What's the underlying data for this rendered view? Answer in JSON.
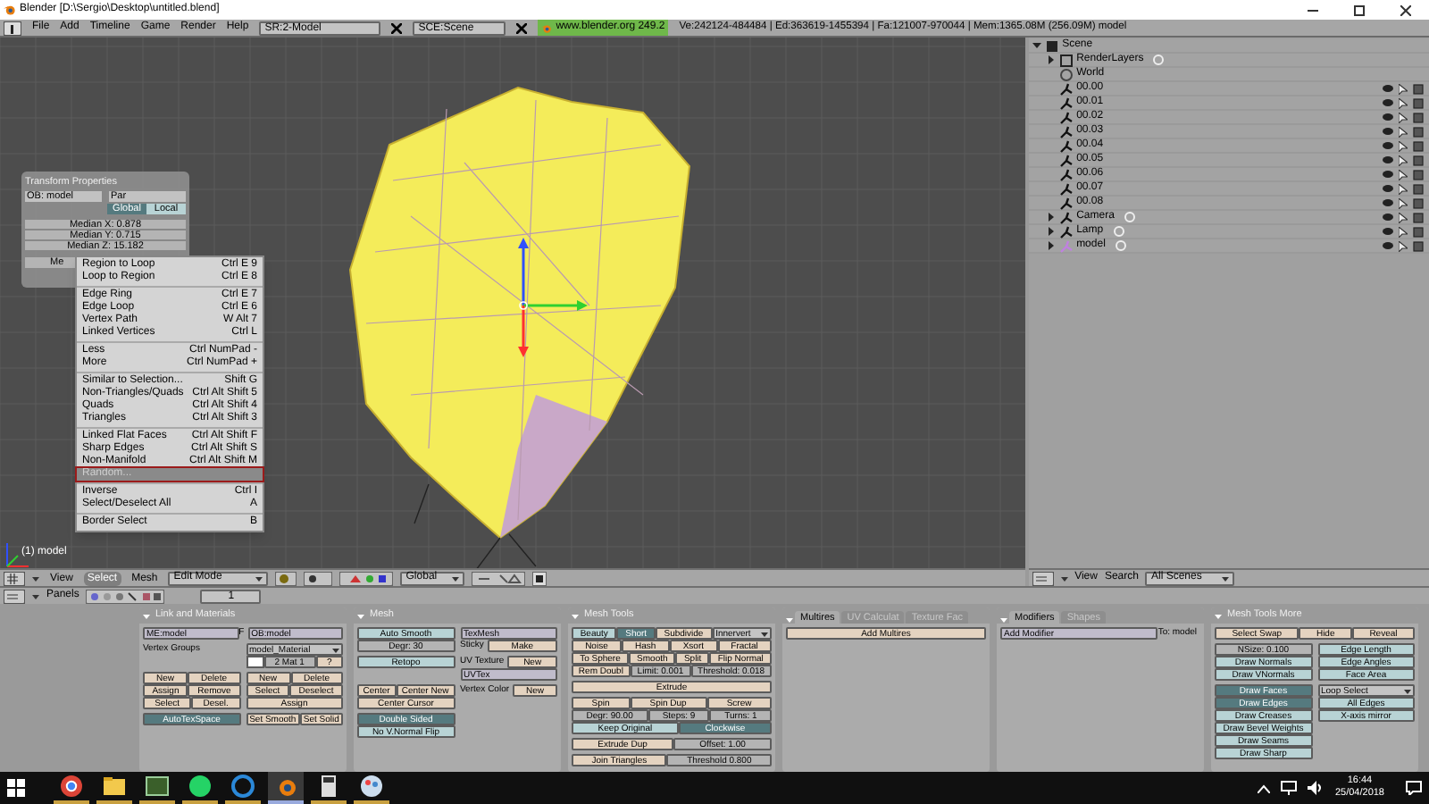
{
  "window": {
    "title": "Blender [D:\\Sergio\\Desktop\\untitled.blend]"
  },
  "menubar": {
    "menus": [
      "File",
      "Add",
      "Timeline",
      "Game",
      "Render",
      "Help"
    ],
    "screen": "SR:2-Model",
    "scene": "SCE:Scene",
    "version": "www.blender.org 249.2",
    "stats": "Ve:242124-484484 | Ed:363619-1455394 | Fa:121007-970044 | Mem:1365.08M (256.09M) model"
  },
  "viewport": {
    "object_label": "(1) model",
    "transform_panel": {
      "title": "Transform Properties",
      "object": "OB: model",
      "parent": "Par",
      "buttons": [
        {
          "label": "Global",
          "selected": true
        },
        {
          "label": "Local",
          "selected": false
        }
      ],
      "fields": [
        "Median X: 0.878",
        "Median Y: 0.715",
        "Median Z: 15.182"
      ],
      "partial_field": "Me"
    },
    "menu": {
      "groups": [
        [
          {
            "label": "Region to Loop",
            "shortcut": "Ctrl E 9",
            "selected": false
          },
          {
            "label": "Loop to Region",
            "shortcut": "Ctrl E 8",
            "selected": false
          }
        ],
        [
          {
            "label": "Edge Ring",
            "shortcut": "Ctrl E 7",
            "selected": false
          },
          {
            "label": "Edge Loop",
            "shortcut": "Ctrl E 6",
            "selected": false
          },
          {
            "label": "Vertex Path",
            "shortcut": "W Alt 7",
            "selected": false
          },
          {
            "label": "Linked Vertices",
            "shortcut": "Ctrl L",
            "selected": false
          }
        ],
        [
          {
            "label": "Less",
            "shortcut": "Ctrl NumPad -",
            "selected": false
          },
          {
            "label": "More",
            "shortcut": "Ctrl NumPad +",
            "selected": false
          }
        ],
        [
          {
            "label": "Similar to Selection...",
            "shortcut": "Shift G",
            "selected": false
          },
          {
            "label": "Non-Triangles/Quads",
            "shortcut": "Ctrl Alt Shift 5",
            "selected": false
          },
          {
            "label": "Quads",
            "shortcut": "Ctrl Alt Shift 4",
            "selected": false
          },
          {
            "label": "Triangles",
            "shortcut": "Ctrl Alt Shift 3",
            "selected": false
          }
        ],
        [
          {
            "label": "Linked Flat Faces",
            "shortcut": "Ctrl Alt Shift F",
            "selected": false
          },
          {
            "label": "Sharp Edges",
            "shortcut": "Ctrl Alt Shift S",
            "selected": false
          },
          {
            "label": "Non-Manifold",
            "shortcut": "Ctrl Alt Shift M",
            "selected": false
          },
          {
            "label": "Random...",
            "selected": true
          }
        ],
        [
          {
            "label": "Inverse",
            "shortcut": "Ctrl I",
            "selected": false
          },
          {
            "label": "Select/Deselect All",
            "shortcut": "A",
            "selected": false
          }
        ],
        [
          {
            "label": "Border Select",
            "shortcut": "B",
            "selected": false
          }
        ]
      ]
    }
  },
  "viewport_header": {
    "menus": [
      {
        "label": "View",
        "selected": false
      },
      {
        "label": "Select",
        "selected": true
      },
      {
        "label": "Mesh",
        "selected": false
      }
    ],
    "mode": "Edit Mode",
    "orientation": "Global"
  },
  "outliner": {
    "tree": [
      {
        "label": "Scene",
        "kind": "scene",
        "expanded": true,
        "children": [
          {
            "label": "RenderLayers",
            "kind": "renderlayers",
            "expanded": false
          },
          {
            "label": "World",
            "kind": "world"
          },
          {
            "label": "00.00",
            "kind": "object"
          },
          {
            "label": "00.01",
            "kind": "object"
          },
          {
            "label": "00.02",
            "kind": "object"
          },
          {
            "label": "00.03",
            "kind": "object"
          },
          {
            "label": "00.04",
            "kind": "object"
          },
          {
            "label": "00.05",
            "kind": "object"
          },
          {
            "label": "00.06",
            "kind": "object"
          },
          {
            "label": "00.07",
            "kind": "object"
          },
          {
            "label": "00.08",
            "kind": "object"
          },
          {
            "label": "Camera",
            "kind": "camera",
            "expanded": false
          },
          {
            "label": "Lamp",
            "kind": "lamp",
            "expanded": false
          },
          {
            "label": "model",
            "kind": "mesh",
            "expanded": false
          }
        ]
      }
    ],
    "header": {
      "menus": [
        "View",
        "Search"
      ],
      "scope": "All Scenes"
    }
  },
  "buttons_header": {
    "label": "Panels",
    "page": "1"
  },
  "panels": [
    {
      "title": "Link and Materials",
      "sections": [
        {
          "columns": [
            [
              [
                {
                  "kind": "field",
                  "text": "ME:model"
                },
                {
                  "kind": "label",
                  "text": "F"
                },
                {
                  "kind": "field",
                  "text": "OB:model"
                }
              ]
            ]
          ]
        },
        {
          "columns": [
            [
              [
                {
                  "kind": "label",
                  "text": "Vertex Groups"
                }
              ]
            ],
            [
              [
                {
                  "kind": "menu",
                  "text": "model_Material"
                }
              ],
              [
                {
                  "kind": "swatch"
                },
                {
                  "kind": "num",
                  "text": "2 Mat 1"
                },
                {
                  "kind": "button",
                  "text": "?"
                }
              ]
            ]
          ]
        },
        {
          "columns": [
            [
              [
                {
                  "kind": "button",
                  "text": "New"
                },
                {
                  "kind": "button",
                  "text": "Delete"
                }
              ],
              [
                {
                  "kind": "button",
                  "text": "Assign"
                },
                {
                  "kind": "button",
                  "text": "Remove"
                }
              ],
              [
                {
                  "kind": "button",
                  "text": "Select"
                },
                {
                  "kind": "button",
                  "text": "Desel."
                }
              ]
            ],
            [
              [
                {
                  "kind": "button",
                  "text": "New"
                },
                {
                  "kind": "button",
                  "text": "Delete"
                }
              ],
              [
                {
                  "kind": "button",
                  "text": "Select"
                },
                {
                  "kind": "button",
                  "text": "Deselect"
                }
              ],
              [
                {
                  "kind": "button",
                  "text": "Assign"
                }
              ]
            ]
          ]
        },
        {
          "columns": [
            [
              [
                {
                  "kind": "toggle",
                  "text": "AutoTexSpace",
                  "on": true
                }
              ]
            ],
            [
              [
                {
                  "kind": "button",
                  "text": "Set Smooth"
                },
                {
                  "kind": "button",
                  "text": "Set Solid"
                }
              ]
            ]
          ]
        }
      ]
    },
    {
      "title": "Mesh",
      "sections": [
        {
          "columns": [
            [
              [
                {
                  "kind": "toggle",
                  "text": "Auto Smooth",
                  "on": false
                }
              ],
              [
                {
                  "kind": "num",
                  "text": "Degr: 30"
                }
              ]
            ],
            [
              [
                {
                  "kind": "field",
                  "text": "TexMesh"
                }
              ],
              [
                {
                  "kind": "label",
                  "text": "Sticky"
                },
                {
                  "kind": "button",
                  "text": "Make"
                }
              ]
            ]
          ]
        },
        {
          "columns": [
            [
              [
                {
                  "kind": "toggle",
                  "text": "Retopo",
                  "on": false
                }
              ]
            ],
            [
              [
                {
                  "kind": "label",
                  "text": "UV Texture"
                },
                {
                  "kind": "button",
                  "text": "New"
                }
              ],
              [
                {
                  "kind": "field",
                  "text": "UVTex"
                }
              ]
            ]
          ]
        },
        {
          "columns": [
            [
              [
                {
                  "kind": "button",
                  "text": "Center"
                },
                {
                  "kind": "button",
                  "text": "Center New"
                }
              ],
              [
                {
                  "kind": "button",
                  "text": "Center Cursor"
                }
              ]
            ],
            [
              [
                {
                  "kind": "label",
                  "text": "Vertex Color"
                },
                {
                  "kind": "button",
                  "text": "New"
                }
              ]
            ]
          ]
        },
        {
          "columns": [
            [
              [
                {
                  "kind": "toggle",
                  "text": "Double Sided",
                  "on": true
                }
              ],
              [
                {
                  "kind": "toggle",
                  "text": "No V.Normal Flip",
                  "on": false
                }
              ]
            ],
            []
          ]
        }
      ]
    },
    {
      "title": "Mesh Tools",
      "sections": [
        {
          "columns": [
            [
              [
                {
                  "kind": "toggle",
                  "text": "Beauty",
                  "on": false
                },
                {
                  "kind": "toggle",
                  "text": "Short",
                  "on": true
                },
                {
                  "kind": "button",
                  "text": "Subdivide"
                },
                {
                  "kind": "menu",
                  "text": "Innervert"
                }
              ],
              [
                {
                  "kind": "button",
                  "text": "Noise"
                },
                {
                  "kind": "button",
                  "text": "Hash"
                },
                {
                  "kind": "button",
                  "text": "Xsort"
                },
                {
                  "kind": "button",
                  "text": "Fractal"
                }
              ],
              [
                {
                  "kind": "button",
                  "text": "To Sphere"
                },
                {
                  "kind": "button",
                  "text": "Smooth"
                },
                {
                  "kind": "button",
                  "text": "Split"
                },
                {
                  "kind": "button",
                  "text": "Flip Normal"
                }
              ],
              [
                {
                  "kind": "button",
                  "text": "Rem Doubl"
                },
                {
                  "kind": "num",
                  "text": "Limit: 0.001"
                },
                {
                  "kind": "num",
                  "text": "Threshold: 0.018"
                }
              ]
            ]
          ]
        },
        {
          "columns": [
            [
              [
                {
                  "kind": "button",
                  "text": "Extrude"
                }
              ]
            ]
          ]
        },
        {
          "columns": [
            [
              [
                {
                  "kind": "button",
                  "text": "Spin"
                },
                {
                  "kind": "button",
                  "text": "Spin Dup"
                },
                {
                  "kind": "button",
                  "text": "Screw"
                }
              ],
              [
                {
                  "kind": "num",
                  "text": "Degr: 90.00"
                },
                {
                  "kind": "num",
                  "text": "Steps: 9"
                },
                {
                  "kind": "num",
                  "text": "Turns: 1"
                }
              ],
              [
                {
                  "kind": "toggle",
                  "text": "Keep Original",
                  "on": false
                },
                {
                  "kind": "toggle",
                  "text": "Clockwise",
                  "on": true
                }
              ]
            ]
          ]
        },
        {
          "columns": [
            [
              [
                {
                  "kind": "button",
                  "text": "Extrude Dup"
                },
                {
                  "kind": "num",
                  "text": "Offset: 1.00"
                }
              ]
            ]
          ]
        },
        {
          "columns": [
            [
              [
                {
                  "kind": "button",
                  "text": "Join Triangles"
                },
                {
                  "kind": "num",
                  "text": "Threshold 0.800"
                }
              ]
            ]
          ]
        }
      ]
    },
    {
      "tabs": [
        {
          "label": "Multires",
          "selected": true
        },
        {
          "label": "UV Calculat",
          "selected": false
        },
        {
          "label": "Texture Fac",
          "selected": false
        }
      ],
      "sections": [
        {
          "columns": [
            [
              [
                {
                  "kind": "button",
                  "text": "Add Multires"
                }
              ]
            ]
          ]
        }
      ]
    },
    {
      "tabs": [
        {
          "label": "Modifiers",
          "selected": true
        },
        {
          "label": "Shapes",
          "selected": false
        }
      ],
      "sections": [
        {
          "columns": [
            [
              [
                {
                  "kind": "field",
                  "text": "Add Modifier"
                },
                {
                  "kind": "label",
                  "text": "To: model"
                }
              ]
            ]
          ]
        }
      ]
    },
    {
      "title": "Mesh Tools More",
      "sections": [
        {
          "columns": [
            [
              [
                {
                  "kind": "button",
                  "text": "Select Swap"
                },
                {
                  "kind": "button",
                  "text": "Hide"
                },
                {
                  "kind": "button",
                  "text": "Reveal"
                }
              ]
            ]
          ]
        },
        {
          "columns": [
            [
              [
                {
                  "kind": "num",
                  "text": "NSize: 0.100"
                }
              ],
              [
                {
                  "kind": "toggle",
                  "text": "Draw Normals",
                  "on": false
                }
              ],
              [
                {
                  "kind": "toggle",
                  "text": "Draw VNormals",
                  "on": false
                }
              ]
            ],
            [
              [
                {
                  "kind": "toggle",
                  "text": "Edge Length",
                  "on": false
                }
              ],
              [
                {
                  "kind": "toggle",
                  "text": "Edge Angles",
                  "on": false
                }
              ],
              [
                {
                  "kind": "toggle",
                  "text": "Face Area",
                  "on": false
                }
              ]
            ]
          ]
        },
        {
          "columns": [
            [
              [
                {
                  "kind": "toggle",
                  "text": "Draw Faces",
                  "on": true
                }
              ],
              [
                {
                  "kind": "toggle",
                  "text": "Draw Edges",
                  "on": true
                }
              ],
              [
                {
                  "kind": "toggle",
                  "text": "Draw Creases",
                  "on": false
                }
              ],
              [
                {
                  "kind": "toggle",
                  "text": "Draw Bevel Weights",
                  "on": false
                }
              ],
              [
                {
                  "kind": "toggle",
                  "text": "Draw Seams",
                  "on": false
                }
              ],
              [
                {
                  "kind": "toggle",
                  "text": "Draw Sharp",
                  "on": false
                }
              ]
            ],
            [
              [
                {
                  "kind": "menu",
                  "text": "Loop Select"
                }
              ],
              [
                {
                  "kind": "toggle",
                  "text": "All Edges",
                  "on": false
                }
              ],
              [
                {
                  "kind": "toggle",
                  "text": "X-axis mirror",
                  "on": false
                }
              ]
            ]
          ]
        }
      ]
    }
  ],
  "taskbar": {
    "apps": [
      {
        "kind": "browser",
        "selected": false
      },
      {
        "kind": "folder",
        "selected": false
      },
      {
        "kind": "monitor",
        "selected": false
      },
      {
        "kind": "chat",
        "selected": false
      },
      {
        "kind": "edge",
        "selected": false
      },
      {
        "kind": "blender",
        "selected": true
      },
      {
        "kind": "calculator",
        "selected": false
      },
      {
        "kind": "paint",
        "selected": false
      }
    ],
    "time": "16:44",
    "date": "25/04/2018"
  }
}
